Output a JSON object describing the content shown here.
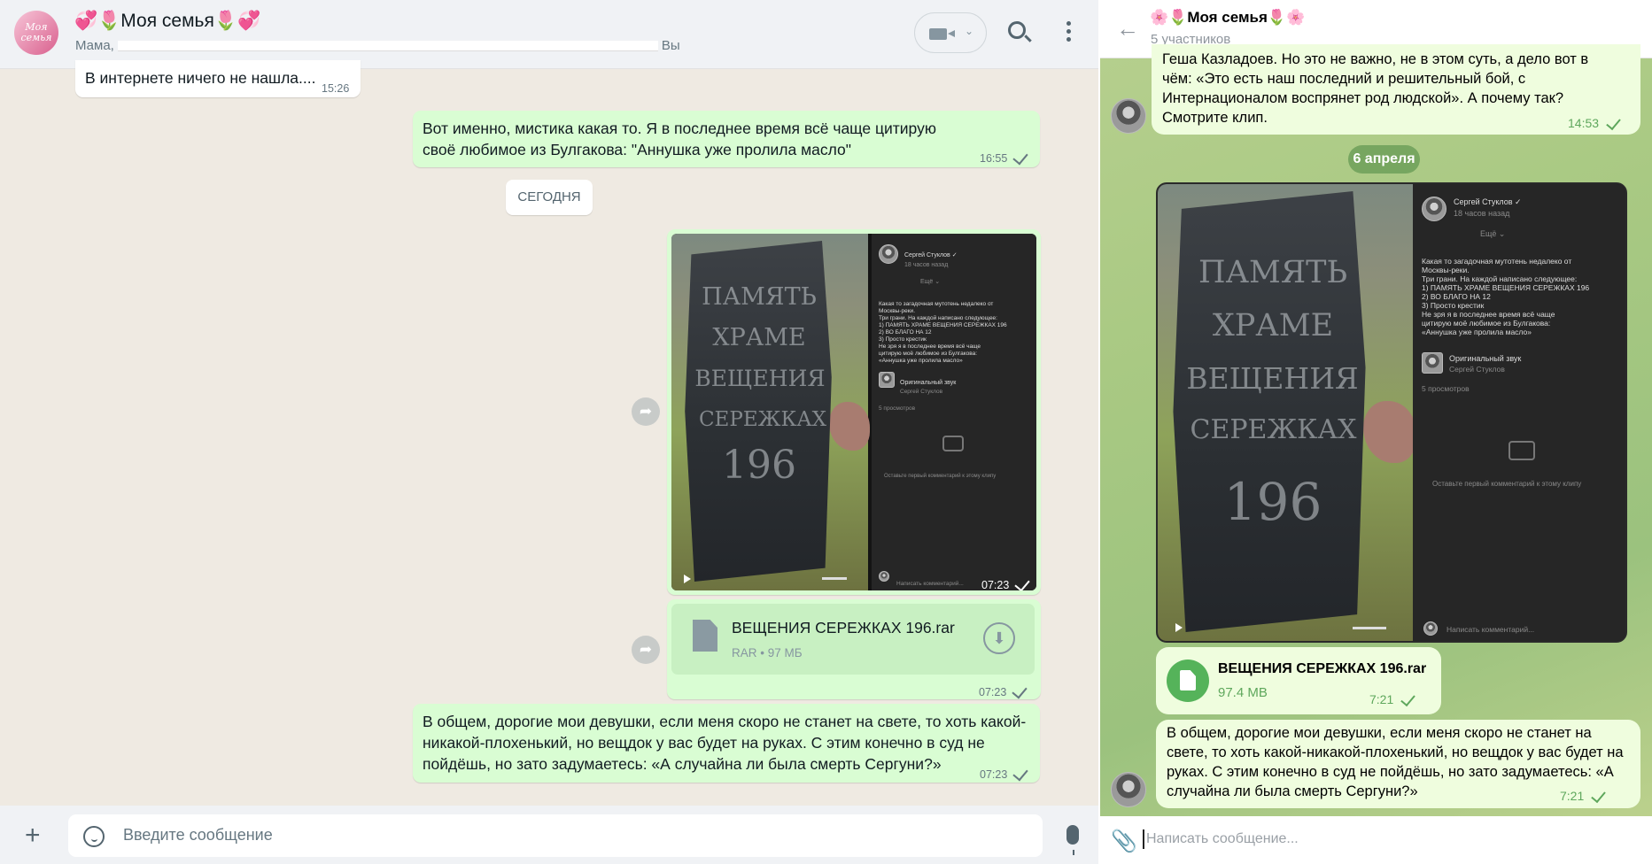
{
  "whatsapp": {
    "header": {
      "avatar_text": "Моя семья",
      "title": "💞🌷Моя семья🌷💞",
      "members_start": "Мама,",
      "members_end": "Вы",
      "video_chevron": "⌄"
    },
    "messages": {
      "m1_text": "В интернете ничего не нашла....",
      "m1_time": "15:26",
      "m2_text": "Вот именно, мистика какая то. Я в последнее время всё чаще цитирую своё любимое из Булгакова: \"Аннушка уже пролила масло\"",
      "m2_time": "16:55",
      "date_separator": "СЕГОДНЯ",
      "video_time": "07:23",
      "file_name": "ВЕЩЕНИЯ СЕРЕЖКАХ 196.rar",
      "file_meta": "RAR • 97 МБ",
      "file_time": "07:23",
      "m3_text": "В общем, дорогие мои девушки, если меня скоро не станет на свете, то хоть какой-никакой-плохенький, но вещдок у вас будет на руках. С этим конечно в суд не пойдёшь, но зато задумаетесь: «А случайна ли была смерть Сергуни?»",
      "m3_time": "07:23"
    },
    "input": {
      "placeholder": "Введите сообщение",
      "plus": "+"
    },
    "icons": [
      "video-call-icon",
      "search-icon",
      "menu-icon",
      "forward-icon",
      "file-icon",
      "download-icon",
      "sticker-icon",
      "mic-icon"
    ]
  },
  "screenshot_in_video": {
    "carving": [
      "ПАМЯТЬ",
      "ХРАМЕ",
      "ВЕЩЕНИЯ",
      "СЕРЕЖКАХ",
      "196"
    ],
    "author": "Сергей Стуклов ✓",
    "author_meta": "18 часов назад",
    "more": "Ещё ⌄",
    "desc_lines": [
      "Какая то загадочная мутотень недалеко от",
      "Москвы-реки.",
      "Три грани. На каждой написано следующее:",
      "1) ПАМЯТЬ ХРАМЕ ВЕЩЕНИЯ СЕРЕЖКАХ 196",
      "2) ВО БЛАГО НА 12",
      "3) Просто крестик",
      "Не зря я в последнее время всё чаще",
      "цитирую моё любимое из Булгакова:",
      "«Аннушка уже пролила масло»"
    ],
    "sound_title": "Оригинальный звук",
    "sound_author": "Сергей Стуклов",
    "views": "5 просмотров",
    "no_comments": "Оставьте первый комментарий к этому клипу",
    "comment_placeholder": "Написать комментарий..."
  },
  "telegram": {
    "header": {
      "back": "←",
      "title": "🌸🌷Моя семья🌷🌸",
      "subtitle": "5 участников"
    },
    "messages": {
      "prev_line1": "Гешa Казладоев. Но это не важно, не в этом суть, а дело вот в",
      "prev_line2": "чём: «Это есть наш последний и решительный бой, с",
      "prev_line3": "Интернационалом воспрянет род людской». А почему так?",
      "prev_line4": "Смотрите клип.",
      "prev_time": "14:53",
      "date_separator": "6 апреля",
      "file_name": "ВЕЩЕНИЯ СЕРЕЖКАХ 196.rar",
      "file_size": "97.4 MB",
      "file_time": "7:21",
      "last_text": "В общем, дорогие мои девушки, если меня скоро не станет на свете, то хоть какой-никакой-плохенький, но вещдок у вас будет на руках. С этим конечно в суд не пойдёшь, но зато задумаетесь: «А случайна ли была смерть Сергуни?»",
      "last_time": "7:21"
    },
    "input": {
      "placeholder": "Написать сообщение...",
      "clip": "📎"
    },
    "colors": {
      "bubble": "#effdde",
      "accent": "#5ea75c",
      "date_chip": "#6a9a58"
    }
  },
  "colors": {
    "wa_background": "#efeae2",
    "wa_outgoing": "#d9fdd3",
    "wa_incoming": "#ffffff"
  }
}
